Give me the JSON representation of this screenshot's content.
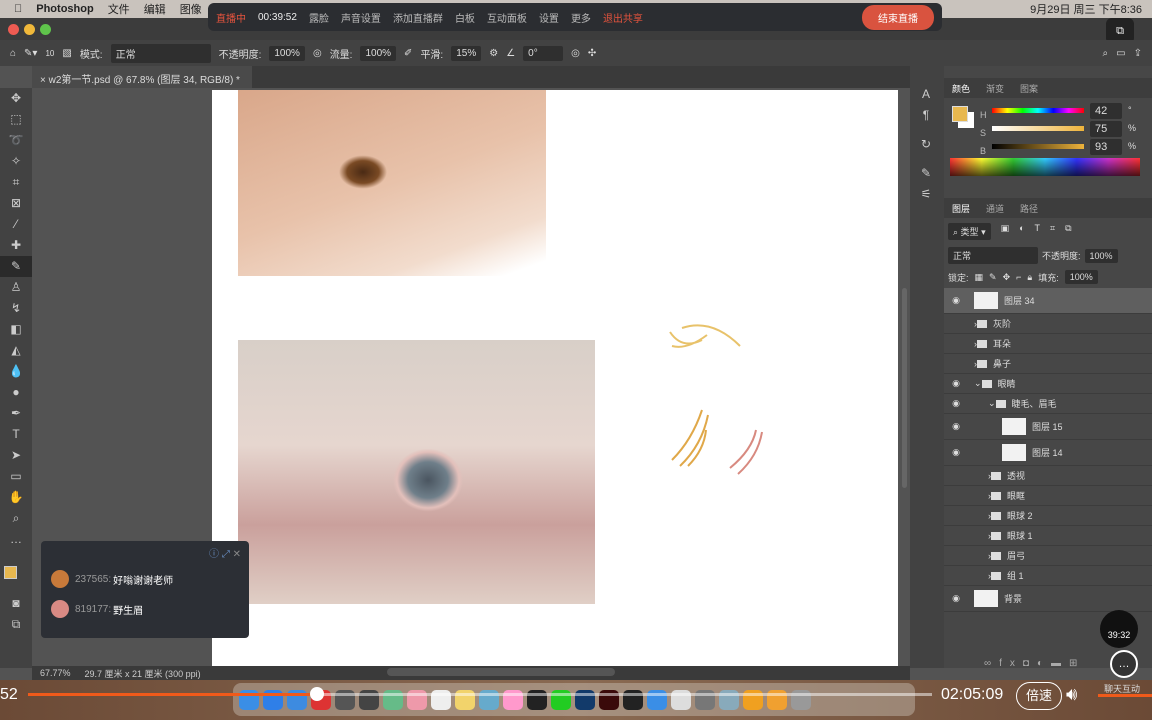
{
  "menubar": {
    "app": "Photoshop",
    "items": [
      "文件",
      "编辑",
      "图像"
    ],
    "datetime": "9月29日 周三 下午8:36"
  },
  "livebar": {
    "status": "直播中",
    "elapsed": "00:39:52",
    "items": [
      "露脸",
      "声音设置",
      "添加直播群",
      "白板",
      "互动面板",
      "设置",
      "更多"
    ],
    "exit_share": "退出共享",
    "end_live": "结束直播"
  },
  "options": {
    "mode_label": "模式:",
    "mode": "正常",
    "opacity_label": "不透明度:",
    "opacity": "100%",
    "flow_label": "流量:",
    "flow": "100%",
    "smooth_label": "平滑:",
    "smooth": "15%",
    "angle": "0°",
    "brush_size": "10"
  },
  "document": {
    "tab": "w2第一节.psd @ 67.8% (图层 34, RGB/8) *",
    "zoom": "67.77%",
    "size": "29.7 厘米 x 21 厘米 (300 ppi)"
  },
  "color_panel": {
    "tabs": [
      "颜色",
      "渐变",
      "图案"
    ],
    "H": "42",
    "S": "75",
    "B": "93",
    "h_unit": "°",
    "s_unit": "%",
    "b_unit": "%",
    "foreground": "#e8b84f",
    "background": "#ffffff"
  },
  "layers_panel": {
    "tabs": [
      "图层",
      "通道",
      "路径"
    ],
    "filter": "类型",
    "blend": "正常",
    "opacity_label": "不透明度:",
    "opacity": "100%",
    "lock_label": "锁定:",
    "fill_label": "填充:",
    "fill": "100%",
    "layers": [
      {
        "name": "图层 34",
        "visible": true,
        "type": "layer",
        "depth": 0,
        "selected": true
      },
      {
        "name": "灰阶",
        "visible": false,
        "type": "group",
        "depth": 0
      },
      {
        "name": "耳朵",
        "visible": false,
        "type": "group",
        "depth": 0
      },
      {
        "name": "鼻子",
        "visible": false,
        "type": "group",
        "depth": 0
      },
      {
        "name": "眼睛",
        "visible": true,
        "type": "group-open",
        "depth": 0
      },
      {
        "name": "睫毛、眉毛",
        "visible": true,
        "type": "group-open",
        "depth": 1
      },
      {
        "name": "图层 15",
        "visible": true,
        "type": "layer",
        "depth": 2
      },
      {
        "name": "图层 14",
        "visible": true,
        "type": "layer",
        "depth": 2
      },
      {
        "name": "透视",
        "visible": false,
        "type": "group",
        "depth": 1
      },
      {
        "name": "眼眶",
        "visible": false,
        "type": "group",
        "depth": 1
      },
      {
        "name": "眼球 2",
        "visible": false,
        "type": "group",
        "depth": 1
      },
      {
        "name": "眼球 1",
        "visible": false,
        "type": "group",
        "depth": 1
      },
      {
        "name": "眉弓",
        "visible": false,
        "type": "group",
        "depth": 1
      },
      {
        "name": "组 1",
        "visible": false,
        "type": "group",
        "depth": 1
      },
      {
        "name": "背景",
        "visible": true,
        "type": "layer",
        "depth": 0
      }
    ]
  },
  "chat": {
    "messages": [
      {
        "user": "237565:",
        "text": "好嗡谢谢老师"
      },
      {
        "user": "819177:",
        "text": "野生眉"
      }
    ]
  },
  "player": {
    "current": "52",
    "total": "02:05:09",
    "speed": "倍速",
    "chat_label": "聊天互动",
    "timer": "39:32",
    "progress_percent": 32,
    "accent": "#f05a1a"
  }
}
